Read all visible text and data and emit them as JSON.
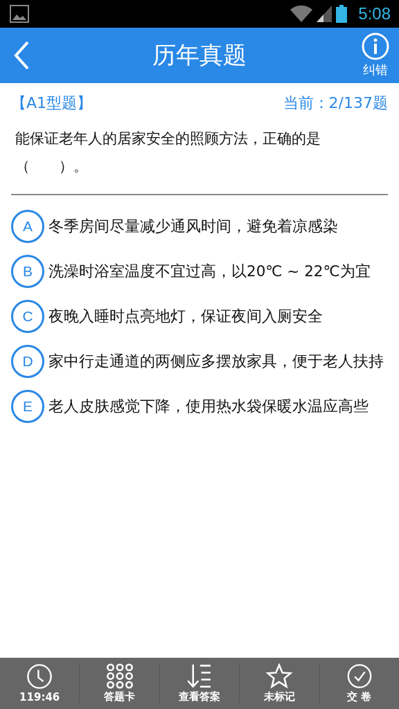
{
  "status_bar": {
    "time": "5:08"
  },
  "header": {
    "title": "历年真题",
    "report_label": "纠错"
  },
  "question": {
    "type_label": "【A1型题】",
    "progress": "当前：2/137题",
    "text_lines": [
      "能保证老年人的居家安全的照顾方法，正确的是",
      "（　　）。"
    ]
  },
  "options": [
    {
      "letter": "A",
      "text": "冬季房间尽量减少通风时间，避免着凉感染",
      "selected": false
    },
    {
      "letter": "B",
      "text": "洗澡时浴室温度不宜过高，以20℃ ~ 22℃为宜",
      "selected": false
    },
    {
      "letter": "C",
      "text": "夜晚入睡时点亮地灯，保证夜间入厕安全",
      "selected": false
    },
    {
      "letter": "D",
      "text": "家中行走通道的两侧应多摆放家具，便于老人扶持",
      "selected": false
    },
    {
      "letter": "E",
      "text": "老人皮肤感觉下降，使用热水袋保暖水温应高些",
      "selected": false
    }
  ],
  "toolbar": [
    {
      "kind": "timer",
      "label": "119:46"
    },
    {
      "kind": "card",
      "label": "答题卡"
    },
    {
      "kind": "answer",
      "label": "查看答案"
    },
    {
      "kind": "mark",
      "label": "未标记"
    },
    {
      "kind": "submit",
      "label": "交 卷"
    }
  ]
}
